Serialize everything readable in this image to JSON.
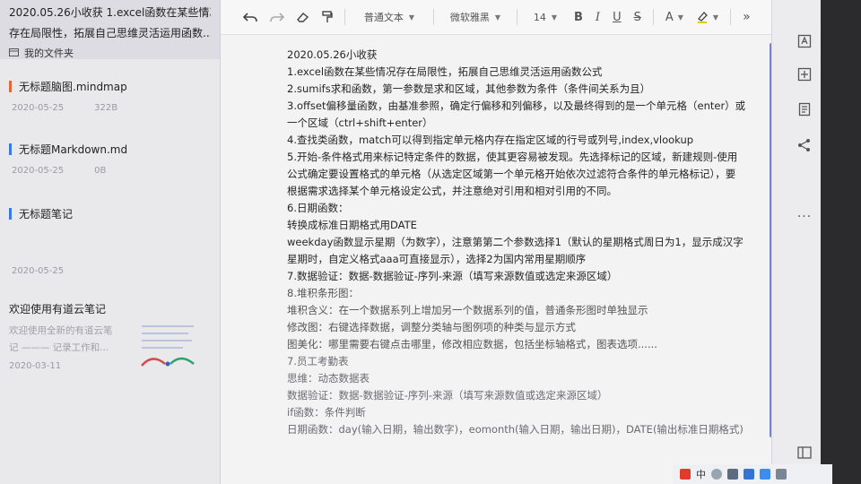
{
  "sidebar": {
    "selected_note": {
      "title_line1": "2020.05.26小收获 1.excel函数在某些情况",
      "title_line2": "存在局限性，拓展自己思维灵活运用函数...",
      "folder": "我的文件夹"
    },
    "notes": [
      {
        "title": "无标题脑图.mindmap",
        "date": "2020-05-25",
        "size": "322B"
      },
      {
        "title": "无标题Markdown.md",
        "date": "2020-05-25",
        "size": "0B"
      },
      {
        "title": "无标题笔记",
        "date": "2020-05-25",
        "size": ""
      },
      {
        "title": "欢迎使用有道云笔记",
        "preview_line1": "欢迎使用全新的有道云笔",
        "preview_line2": "记 ——— 记录工作和...",
        "date": "2020-03-11"
      }
    ]
  },
  "toolbar": {
    "undo_icon": "undo-icon",
    "redo_icon": "redo-icon",
    "eraser_icon": "eraser-icon",
    "format_painter_icon": "format-painter-icon",
    "paragraph_style": "普通文本",
    "font_family": "微软雅黑",
    "font_size": "14",
    "bold": "B",
    "italic": "I",
    "underline": "U",
    "strike": "S",
    "font_color": "A",
    "more": "»"
  },
  "doc_lines": [
    "2020.05.26小收获",
    "1.excel函数在某些情况存在局限性，拓展自己思维灵活运用函数公式",
    "2.sumifs求和函数，第一参数是求和区域，其他参数为条件（条件间关系为且）",
    "3.offset偏移量函数，由基准参照，确定行偏移和列偏移，以及最终得到的是一个单元格（enter）或",
    "一个区域（ctrl+shift+enter）",
    "4.查找类函数，match可以得到指定单元格内存在指定区域的行号或列号,index,vlookup",
    "5.开始-条件格式用来标记特定条件的数据，使其更容易被发现。先选择标记的区域，新建规则-使用",
    "公式确定要设置格式的单元格（从选定区域第一个单元格开始依次过滤符合条件的单元格标记），要",
    "根据需求选择某个单元格设定公式，并注意绝对引用和相对引用的不同。",
    "6.日期函数：",
    "转换成标准日期格式用DATE",
    "weekday函数显示星期（为数字），注意第第二个参数选择1（默认的星期格式周日为1，显示成汉字",
    "星期时，自定义格式aaa可直接显示），选择2为国内常用星期顺序",
    "7.数据验证：数据-数据验证-序列-来源（填写来源数值或选定来源区域）",
    "8.堆积条形图：",
    "堆积含义：在一个数据系列上增加另一个数据系列的值，普通条形图时单独显示",
    "修改图：右键选择数据，调整分类轴与图例项的种类与显示方式",
    "图美化：哪里需要右键点击哪里，修改相应数据，包括坐标轴格式，图表选项......",
    "7.员工考勤表",
    "思维：动态数据表",
    "数据验证：数据-数据验证-序列-来源（填写来源数值或选定来源区域）",
    "if函数：条件判断",
    "日期函数：day(输入日期，输出数字)，eomonth(输入日期，输出日期)，DATE(输出标准日期格式)"
  ],
  "rail": {
    "icons": [
      "layout-icon",
      "add-icon",
      "outline-icon",
      "share-icon",
      "more-icon",
      "panel-icon"
    ],
    "more_label": "..."
  },
  "taskbar": {
    "ime_label": "中"
  },
  "colors": {
    "scrollbar": "#7b7fd6",
    "mindmap_marker": "#e0683a",
    "note_marker": "#3b78e7"
  }
}
